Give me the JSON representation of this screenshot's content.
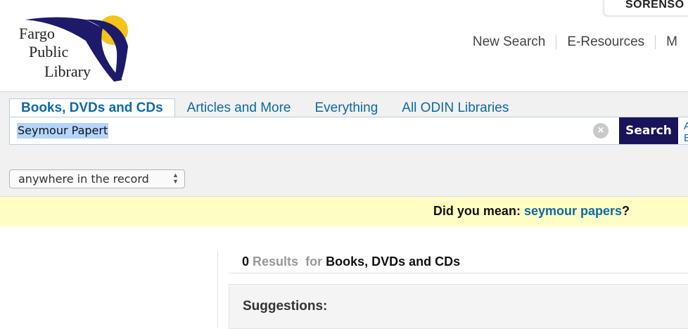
{
  "header": {
    "user_name": "SORENSO",
    "logo": {
      "line1": "Fargo",
      "line2": "Public",
      "line3": "Library",
      "colors": {
        "swoosh": "#1e1a6b",
        "sun": "#f6c21b",
        "text": "#222222"
      }
    },
    "nav": [
      {
        "label": "New Search"
      },
      {
        "label": "E-Resources"
      },
      {
        "label": "M"
      }
    ]
  },
  "search": {
    "tabs": [
      {
        "label": "Books, DVDs and CDs",
        "active": true
      },
      {
        "label": "Articles and More",
        "active": false
      },
      {
        "label": "Everything",
        "active": false
      },
      {
        "label": "All ODIN Libraries",
        "active": false
      }
    ],
    "query": "Seymour Papert",
    "clear_icon": "close-icon",
    "button_label": "Search",
    "adv_link": "A\nE"
  },
  "scope": {
    "selected": "anywhere in the record"
  },
  "did_you_mean": {
    "prefix": "Did you mean: ",
    "suggestion": "seymour papers",
    "suffix": "?"
  },
  "results": {
    "count": "0",
    "results_word": "Results",
    "for_word": "for",
    "scope_label": "Books, DVDs and CDs",
    "suggestions_title": "Suggestions:"
  },
  "colors": {
    "link_blue": "#0d69a8",
    "search_button": "#19135a",
    "dym_background": "#fefdc4",
    "band_background": "#f1f1f1"
  }
}
